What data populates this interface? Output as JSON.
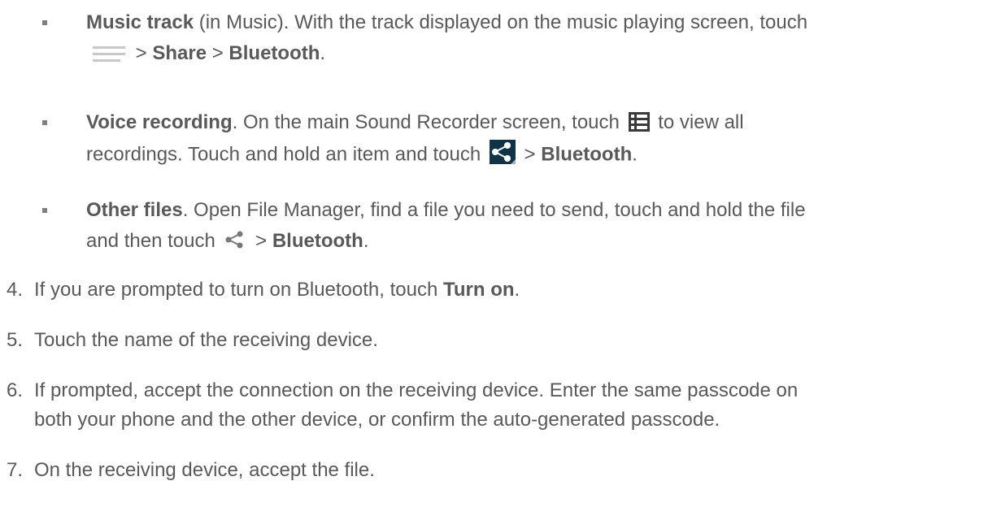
{
  "bullets": [
    {
      "title": "Music track",
      "text1": " (in Music). With the track displayed on the music playing screen, touch",
      "sep1": " > ",
      "share": "Share",
      "sep2": " > ",
      "bluetooth": "Bluetooth",
      "end": ".",
      "icon": "menu-icon"
    },
    {
      "title": "Voice recording",
      "text1": ". On the main Sound Recorder screen, touch ",
      "text2": " to view all",
      "line2": "recordings. Touch and hold an item and touch ",
      "sep": " > ",
      "bluetooth": "Bluetooth",
      "end": ".",
      "icons": [
        "list-icon",
        "share-icon"
      ]
    },
    {
      "title": "Other files",
      "text1": ". Open File Manager, find a file you need to send, touch and hold the file",
      "line2": "and then touch ",
      "sep": " > ",
      "bluetooth": "Bluetooth",
      "end": ".",
      "icon": "share-icon"
    }
  ],
  "steps": [
    {
      "num": "4.",
      "text": "If you are prompted to turn on Bluetooth, touch ",
      "bold": "Turn on",
      "end": "."
    },
    {
      "num": "5.",
      "text": "Touch the name of the receiving device."
    },
    {
      "num": "6.",
      "text": "If prompted, accept the connection on the receiving device. Enter the same passcode on",
      "line2": "both your phone and the other device, or confirm the auto-generated passcode."
    },
    {
      "num": "7.",
      "text": "On the receiving device, accept the file."
    }
  ],
  "colors": {
    "text": "#595959",
    "bullet": "#7f7f7f",
    "share_icon_bg": "#0f3447"
  }
}
